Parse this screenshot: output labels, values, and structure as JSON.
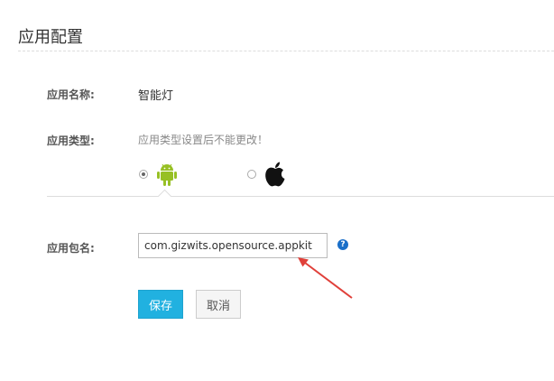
{
  "page": {
    "title": "应用配置"
  },
  "form": {
    "app_name": {
      "label": "应用名称:",
      "value": "智能灯"
    },
    "app_type": {
      "label": "应用类型:",
      "hint": "应用类型设置后不能更改！",
      "options": [
        {
          "name": "android",
          "icon": "android-icon",
          "selected": true
        },
        {
          "name": "ios",
          "icon": "apple-icon",
          "selected": false
        }
      ]
    },
    "package": {
      "label": "应用包名:",
      "value": "com.gizwits.opensource.appkit",
      "help_icon": "question-circle-icon",
      "help_glyph": "?"
    }
  },
  "actions": {
    "save_label": "保存",
    "cancel_label": "取消"
  },
  "colors": {
    "accent": "#21b1e0",
    "android": "#97c024",
    "arrow": "#e0403a",
    "help": "#1a6fc9"
  }
}
